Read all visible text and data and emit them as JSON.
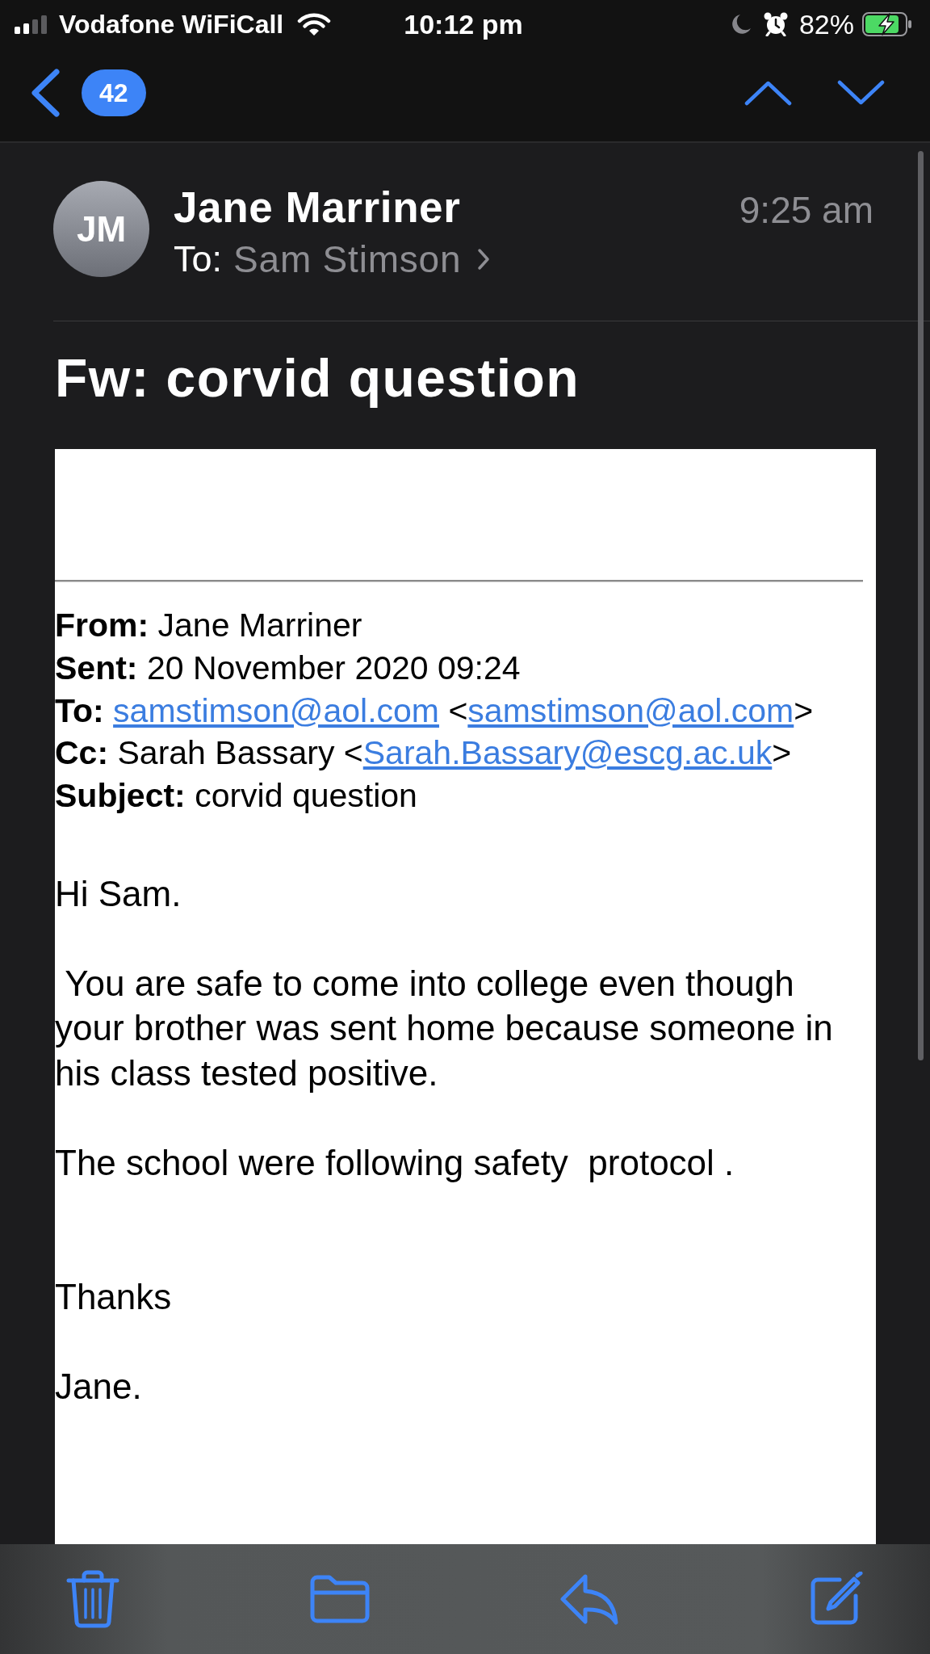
{
  "status_bar": {
    "carrier": "Vodafone WiFiCall",
    "time": "10:12 pm",
    "battery_percent": "82%"
  },
  "nav": {
    "unread_count": "42"
  },
  "message": {
    "avatar_initials": "JM",
    "sender": "Jane Marriner",
    "to_label": "To:",
    "recipient": "Sam Stimson",
    "time": "9:25 am",
    "subject": "Fw: corvid question"
  },
  "body": {
    "header_fields": [
      {
        "label": "From:",
        "parts": [
          {
            "kind": "text",
            "text": "Jane Marriner"
          }
        ]
      },
      {
        "label": "Sent:",
        "parts": [
          {
            "kind": "text",
            "text": "20 November 2020 09:24"
          }
        ]
      },
      {
        "label": "To:",
        "parts": [
          {
            "kind": "link",
            "text": "samstimson@aol.com"
          },
          {
            "kind": "text",
            "text": " <"
          },
          {
            "kind": "link",
            "text": "samstimson@aol.com"
          },
          {
            "kind": "text",
            "text": ">"
          }
        ]
      },
      {
        "label": "Cc:",
        "parts": [
          {
            "kind": "text",
            "text": "Sarah Bassary <"
          },
          {
            "kind": "link",
            "text": "Sarah.Bassary@escg.ac.uk"
          },
          {
            "kind": "text",
            "text": ">"
          }
        ]
      },
      {
        "label": "Subject:",
        "parts": [
          {
            "kind": "text",
            "text": "corvid question"
          }
        ]
      }
    ],
    "text": "Hi Sam.\n\n You are safe to come into college even though your brother was sent home because someone in his class tested positive.\n\nThe school were following safety  protocol .\n\n\nThanks\n\nJane."
  }
}
